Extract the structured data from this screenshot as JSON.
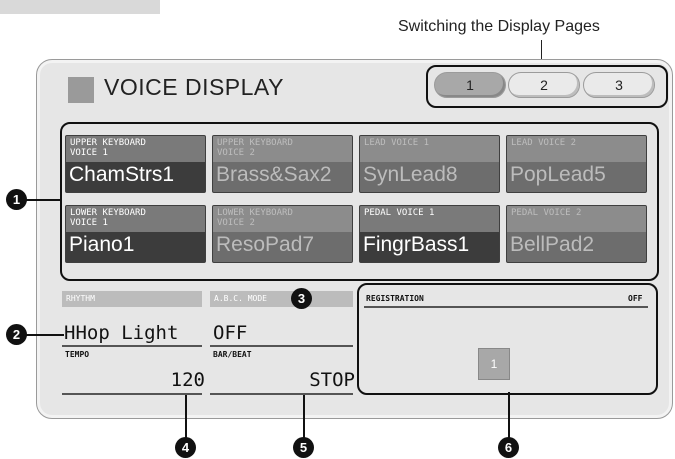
{
  "caption": "Switching the Display Pages",
  "title": "VOICE DISPLAY",
  "pages": [
    {
      "label": "1",
      "active": true
    },
    {
      "label": "2",
      "active": false
    },
    {
      "label": "3",
      "active": false
    }
  ],
  "voices": [
    {
      "category": "UPPER KEYBOARD\nVOICE 1",
      "name": "ChamStrs1",
      "selected": true
    },
    {
      "category": "UPPER KEYBOARD\nVOICE 2",
      "name": "Brass&Sax2",
      "selected": false
    },
    {
      "category": "LEAD VOICE 1",
      "name": "SynLead8",
      "selected": false
    },
    {
      "category": "LEAD VOICE 2",
      "name": "PopLead5",
      "selected": false
    },
    {
      "category": "LOWER KEYBOARD\nVOICE 1",
      "name": "Piano1",
      "selected": true
    },
    {
      "category": "LOWER KEYBOARD\nVOICE 2",
      "name": "ResoPad7",
      "selected": false
    },
    {
      "category": "PEDAL VOICE 1",
      "name": "FingrBass1",
      "selected": true
    },
    {
      "category": "PEDAL VOICE 2",
      "name": "BellPad2",
      "selected": false
    }
  ],
  "rhythm": {
    "label": "RHYTHM",
    "value": "HHop Light"
  },
  "abc_mode": {
    "label": "A.B.C. MODE",
    "value": "OFF"
  },
  "tempo": {
    "label": "TEMPO",
    "value": "120"
  },
  "bar_beat": {
    "label": "BAR/BEAT",
    "value": "STOP"
  },
  "registration": {
    "label": "REGISTRATION",
    "status": "OFF",
    "button": "1"
  },
  "markers": {
    "m1": "1",
    "m2": "2",
    "m3": "3",
    "m4": "4",
    "m5": "5",
    "m6": "6"
  }
}
